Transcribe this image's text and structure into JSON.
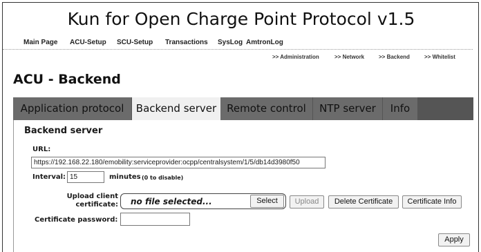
{
  "doc_title": "Kun for Open Charge Point Protocol v1.5",
  "menu": {
    "items": [
      "Main Page",
      "ACU-Setup",
      "SCU-Setup",
      "Transactions",
      "SysLog",
      "AmtronLog"
    ]
  },
  "subnav": {
    "items": [
      ">> Administration",
      ">> Network",
      ">> Backend",
      ">> Whitelist"
    ]
  },
  "page_title": "ACU - Backend",
  "tabs": [
    {
      "label": "Application protocol",
      "state": "inactive"
    },
    {
      "label": "Backend server",
      "state": "selected"
    },
    {
      "label": "Remote control",
      "state": "inactive"
    },
    {
      "label": "NTP server",
      "state": "inactive"
    },
    {
      "label": "Info",
      "state": "inactive"
    }
  ],
  "section": {
    "title": "Backend server",
    "url_label": "URL:",
    "url_value": "https://192.168.22.180/emobility:serviceprovider:ocpp/centralsystem/1/5/db14d3980f50",
    "interval_label": "Interval:",
    "interval_value": "15",
    "interval_unit": "minutes",
    "interval_hint": "(0 to disable)",
    "upload_label_line1": "Upload client",
    "upload_label_line2": "certificate:",
    "file_placeholder": "no file selected...",
    "select_label": "Select",
    "upload_label": "Upload",
    "delete_label": "Delete Certificate",
    "info_label": "Certificate Info",
    "password_label": "Certificate password:",
    "password_value": "",
    "apply_label": "Apply"
  },
  "colors": {
    "tabbar_bg": "#555555",
    "tab_inactive": "#6b6b6b",
    "tab_selected": "#f0f0f0"
  }
}
